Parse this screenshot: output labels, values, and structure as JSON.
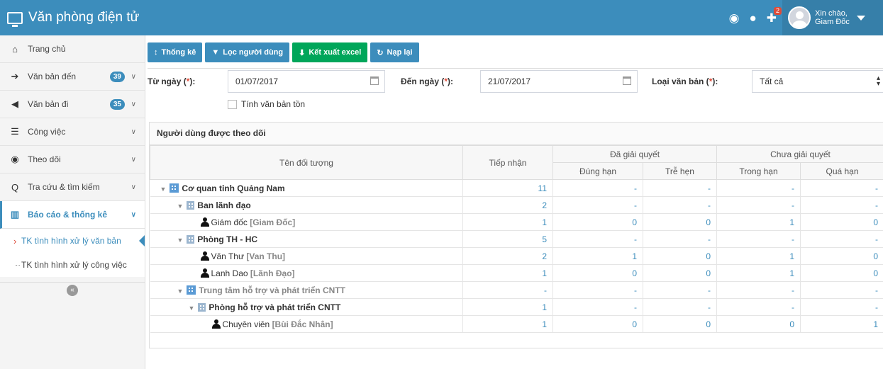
{
  "header": {
    "title": "Văn phòng điện tử",
    "notification_badge": "2",
    "greeting_line1": "Xin chào,",
    "greeting_line2": "Giam Đốc",
    "icons": [
      "globe-icon",
      "chat-icon",
      "puzzle-icon"
    ]
  },
  "sidebar": {
    "items": [
      {
        "label": "Trang chủ",
        "icon": "home-icon"
      },
      {
        "label": "Văn bản đến",
        "icon": "arrow-circle-right-icon",
        "badge": "39"
      },
      {
        "label": "Văn bản đi",
        "icon": "arrow-circle-left-icon",
        "badge": "35"
      },
      {
        "label": "Công việc",
        "icon": "tasks-icon"
      },
      {
        "label": "Theo dõi",
        "icon": "eye-icon"
      },
      {
        "label": "Tra cứu & tìm kiếm",
        "icon": "search-icon"
      },
      {
        "label": "Báo cáo & thống kê",
        "icon": "bar-chart-icon"
      }
    ],
    "subitems": [
      {
        "label": "TK tình hình xử lý văn bản"
      },
      {
        "label": "TK tình hình xử lý công việc"
      }
    ],
    "collapse_label": "«"
  },
  "toolbar": {
    "stats_label": "Thống kê",
    "filter_users_label": "Lọc người dùng",
    "export_label": "Kết xuất excel",
    "reload_label": "Nạp lại"
  },
  "filters": {
    "from_label": "Từ ngày (",
    "to_label": "Đến ngày (",
    "type_label": "Loại văn bản (",
    "req_mark": "*",
    "label_suffix": "):",
    "from_value": "01/07/2017",
    "to_value": "21/07/2017",
    "type_value": "Tất cả",
    "checkbox_label": "Tính văn bản tồn"
  },
  "table": {
    "panel_title": "Người dùng được theo dõi",
    "headers": {
      "name": "Tên đối tượng",
      "received": "Tiếp nhận",
      "resolved": "Đã giải quyết",
      "unresolved": "Chưa giải quyết",
      "on_time": "Đúng hạn",
      "late": "Trễ hẹn",
      "in_time": "Trong hạn",
      "overdue": "Quá hạn"
    },
    "rows": [
      {
        "name": "Cơ quan tỉnh Quảng Nam",
        "alias": "",
        "received": "11",
        "on_time": "-",
        "late": "-",
        "in_time": "-",
        "overdue": "-"
      },
      {
        "name": "Ban lãnh đạo",
        "alias": "",
        "received": "2",
        "on_time": "-",
        "late": "-",
        "in_time": "-",
        "overdue": "-"
      },
      {
        "name": "Giám đốc",
        "alias": "[Giam Đốc]",
        "received": "1",
        "on_time": "0",
        "late": "0",
        "in_time": "1",
        "overdue": "0"
      },
      {
        "name": "Phòng TH - HC",
        "alias": "",
        "received": "5",
        "on_time": "-",
        "late": "-",
        "in_time": "-",
        "overdue": "-"
      },
      {
        "name": "Văn Thư",
        "alias": "[Van Thu]",
        "received": "2",
        "on_time": "1",
        "late": "0",
        "in_time": "1",
        "overdue": "0"
      },
      {
        "name": "Lanh Dao",
        "alias": "[Lãnh Đạo]",
        "received": "1",
        "on_time": "0",
        "late": "0",
        "in_time": "1",
        "overdue": "0"
      },
      {
        "name": "Trung tâm hỗ trợ và phát triển CNTT",
        "alias": "",
        "received": "-",
        "on_time": "-",
        "late": "-",
        "in_time": "-",
        "overdue": "-"
      },
      {
        "name": "Phòng hỗ trợ và phát triển CNTT",
        "alias": "",
        "received": "1",
        "on_time": "-",
        "late": "-",
        "in_time": "-",
        "overdue": "-"
      },
      {
        "name": "Chuyên viên",
        "alias": "[Bùi Đắc Nhân]",
        "received": "1",
        "on_time": "0",
        "late": "0",
        "in_time": "0",
        "overdue": "1"
      }
    ]
  }
}
